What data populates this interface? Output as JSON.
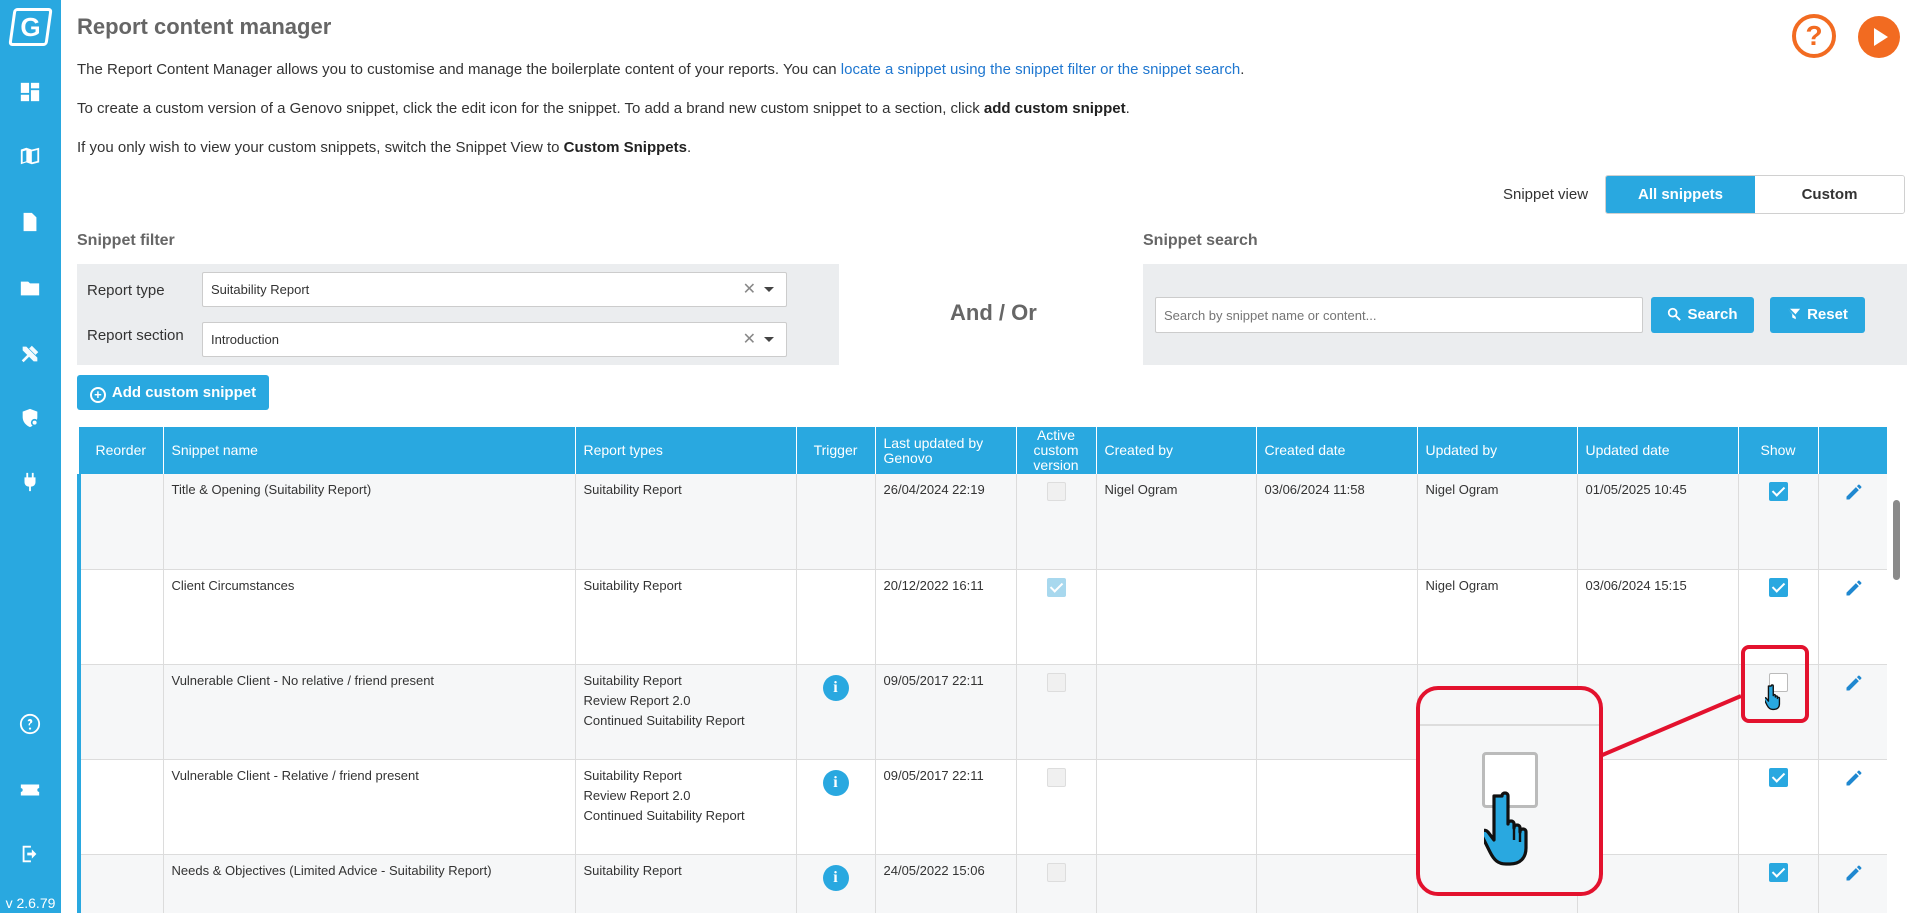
{
  "app": {
    "version": "v 2.6.79"
  },
  "page": {
    "title": "Report content manager",
    "intro1_text": "The Report Content Manager allows you to customise and manage the boilerplate content of your reports. You can ",
    "intro1_link": "locate a snippet using the snippet filter or the snippet search",
    "intro1_end": ".",
    "intro2_text": "To create a custom version of a Genovo snippet, click the edit icon for the snippet. To add a brand new custom snippet to a section, click ",
    "intro2_bold": "add custom snippet",
    "intro2_end": ".",
    "intro3_text": "If you only wish to view your custom snippets, switch the Snippet View to ",
    "intro3_bold": "Custom Snippets",
    "intro3_end": ".",
    "help_label": "?"
  },
  "snippet_view": {
    "label": "Snippet view",
    "options": [
      "All snippets",
      "Custom snippets"
    ],
    "selected": "All snippets"
  },
  "filter": {
    "heading": "Snippet filter",
    "report_type_label": "Report type",
    "report_type_value": "Suitability Report",
    "report_section_label": "Report section",
    "report_section_value": "Introduction",
    "clear_glyph": "✕"
  },
  "and_or": "And / Or",
  "search": {
    "heading": "Snippet search",
    "placeholder": "Search by snippet name or content...",
    "search_label": "Search",
    "reset_label": "Reset"
  },
  "add_custom_snippet_label": "Add custom snippet",
  "table": {
    "headers": {
      "reorder": "Reorder",
      "name": "Snippet name",
      "types": "Report types",
      "trigger": "Trigger",
      "last_updated_genovo": "Last updated by Genovo",
      "active_custom": "Active custom version",
      "created_by": "Created by",
      "created_date": "Created date",
      "updated_by": "Updated by",
      "updated_date": "Updated date",
      "show": "Show"
    },
    "rows": [
      {
        "name": "Title & Opening (Suitability Report)",
        "types": [
          "Suitability Report"
        ],
        "trigger": false,
        "last_updated_genovo": "26/04/2024 22:19",
        "active_custom": false,
        "created_by": "Nigel Ogram",
        "created_date": "03/06/2024 11:58",
        "updated_by": "Nigel Ogram",
        "updated_date": "01/05/2025 10:45",
        "show": true
      },
      {
        "name": "Client Circumstances",
        "types": [
          "Suitability Report"
        ],
        "trigger": false,
        "last_updated_genovo": "20/12/2022 16:11",
        "active_custom": true,
        "created_by": "",
        "created_date": "",
        "updated_by": "Nigel Ogram",
        "updated_date": "03/06/2024 15:15",
        "show": true
      },
      {
        "name": "Vulnerable Client - No relative / friend present",
        "types": [
          "Suitability Report",
          "Review Report 2.0",
          "Continued Suitability Report"
        ],
        "trigger": true,
        "last_updated_genovo": "09/05/2017 22:11",
        "active_custom": false,
        "created_by": "",
        "created_date": "",
        "updated_by": "",
        "updated_date": "",
        "show": false
      },
      {
        "name": "Vulnerable Client - Relative / friend present",
        "types": [
          "Suitability Report",
          "Review Report 2.0",
          "Continued Suitability Report"
        ],
        "trigger": true,
        "last_updated_genovo": "09/05/2017 22:11",
        "active_custom": false,
        "created_by": "",
        "created_date": "",
        "updated_by": "",
        "updated_date": "",
        "show": true
      },
      {
        "name": "Needs & Objectives (Limited Advice - Suitability Report)",
        "types": [
          "Suitability Report"
        ],
        "trigger": true,
        "last_updated_genovo": "24/05/2022 15:06",
        "active_custom": false,
        "created_by": "",
        "created_date": "",
        "updated_by": "",
        "updated_date": "",
        "show": true
      }
    ]
  },
  "colors": {
    "accent": "#29a8e0",
    "orange": "#f26b21",
    "highlight": "#e3122e"
  },
  "icons": {
    "nav": [
      "dashboard-icon",
      "library-icon",
      "document-icon",
      "folder-icon",
      "tools-icon",
      "shield-settings-icon",
      "plug-icon",
      "help-icon",
      "ticket-icon",
      "logout-icon"
    ]
  }
}
